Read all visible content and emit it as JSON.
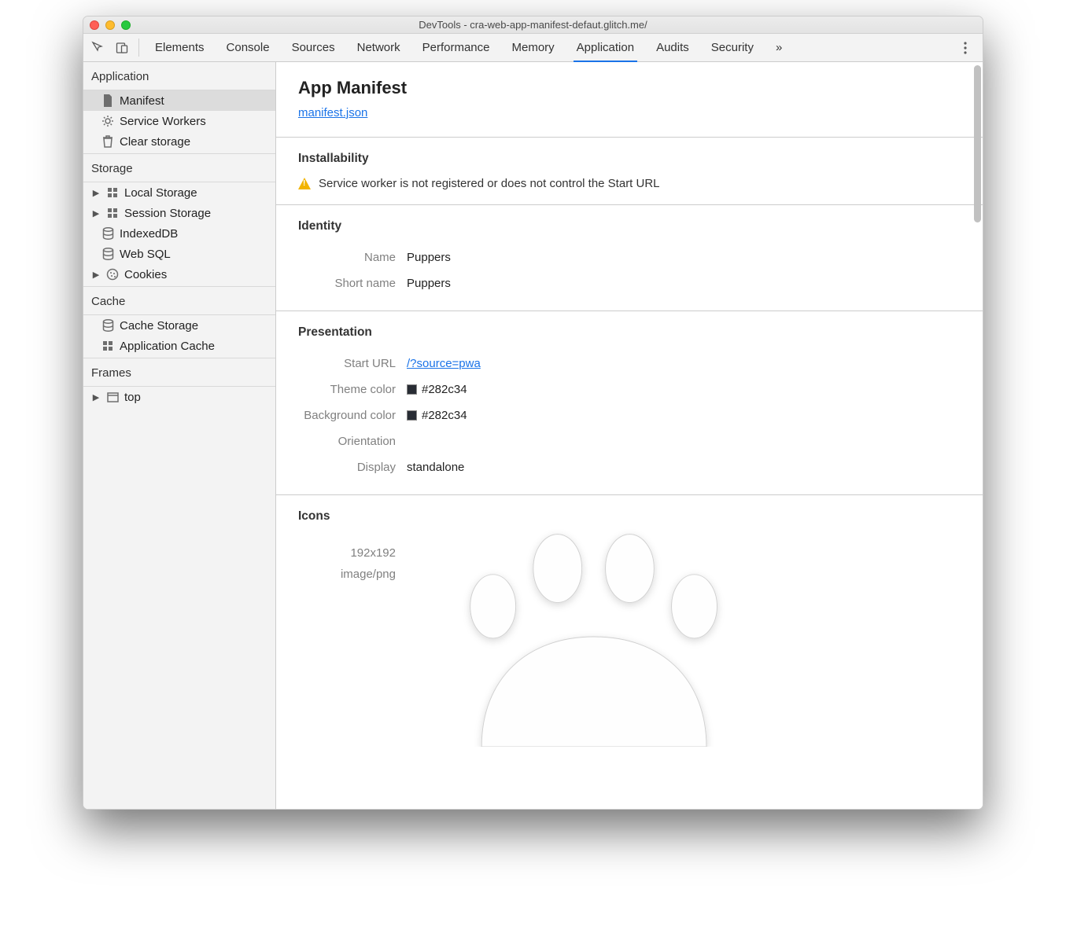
{
  "window": {
    "title": "DevTools - cra-web-app-manifest-defaut.glitch.me/"
  },
  "tabs": {
    "elements": "Elements",
    "console": "Console",
    "sources": "Sources",
    "network": "Network",
    "performance": "Performance",
    "memory": "Memory",
    "application": "Application",
    "audits": "Audits",
    "security": "Security",
    "overflow": "»"
  },
  "sidebar": {
    "application": {
      "title": "Application",
      "manifest": "Manifest",
      "service_workers": "Service Workers",
      "clear_storage": "Clear storage"
    },
    "storage": {
      "title": "Storage",
      "local_storage": "Local Storage",
      "session_storage": "Session Storage",
      "indexeddb": "IndexedDB",
      "web_sql": "Web SQL",
      "cookies": "Cookies"
    },
    "cache": {
      "title": "Cache",
      "cache_storage": "Cache Storage",
      "application_cache": "Application Cache"
    },
    "frames": {
      "title": "Frames",
      "top": "top"
    }
  },
  "main": {
    "heading": "App Manifest",
    "manifest_link": "manifest.json",
    "installability": {
      "title": "Installability",
      "warning": "Service worker is not registered or does not control the Start URL"
    },
    "identity": {
      "title": "Identity",
      "name_label": "Name",
      "name_value": "Puppers",
      "short_name_label": "Short name",
      "short_name_value": "Puppers"
    },
    "presentation": {
      "title": "Presentation",
      "start_url_label": "Start URL",
      "start_url_value": "/?source=pwa",
      "theme_color_label": "Theme color",
      "theme_color_value": "#282c34",
      "bg_color_label": "Background color",
      "bg_color_value": "#282c34",
      "orientation_label": "Orientation",
      "orientation_value": "",
      "display_label": "Display",
      "display_value": "standalone"
    },
    "icons": {
      "title": "Icons",
      "size": "192x192",
      "mime": "image/png"
    }
  },
  "colors": {
    "swatch": "#282c34"
  }
}
